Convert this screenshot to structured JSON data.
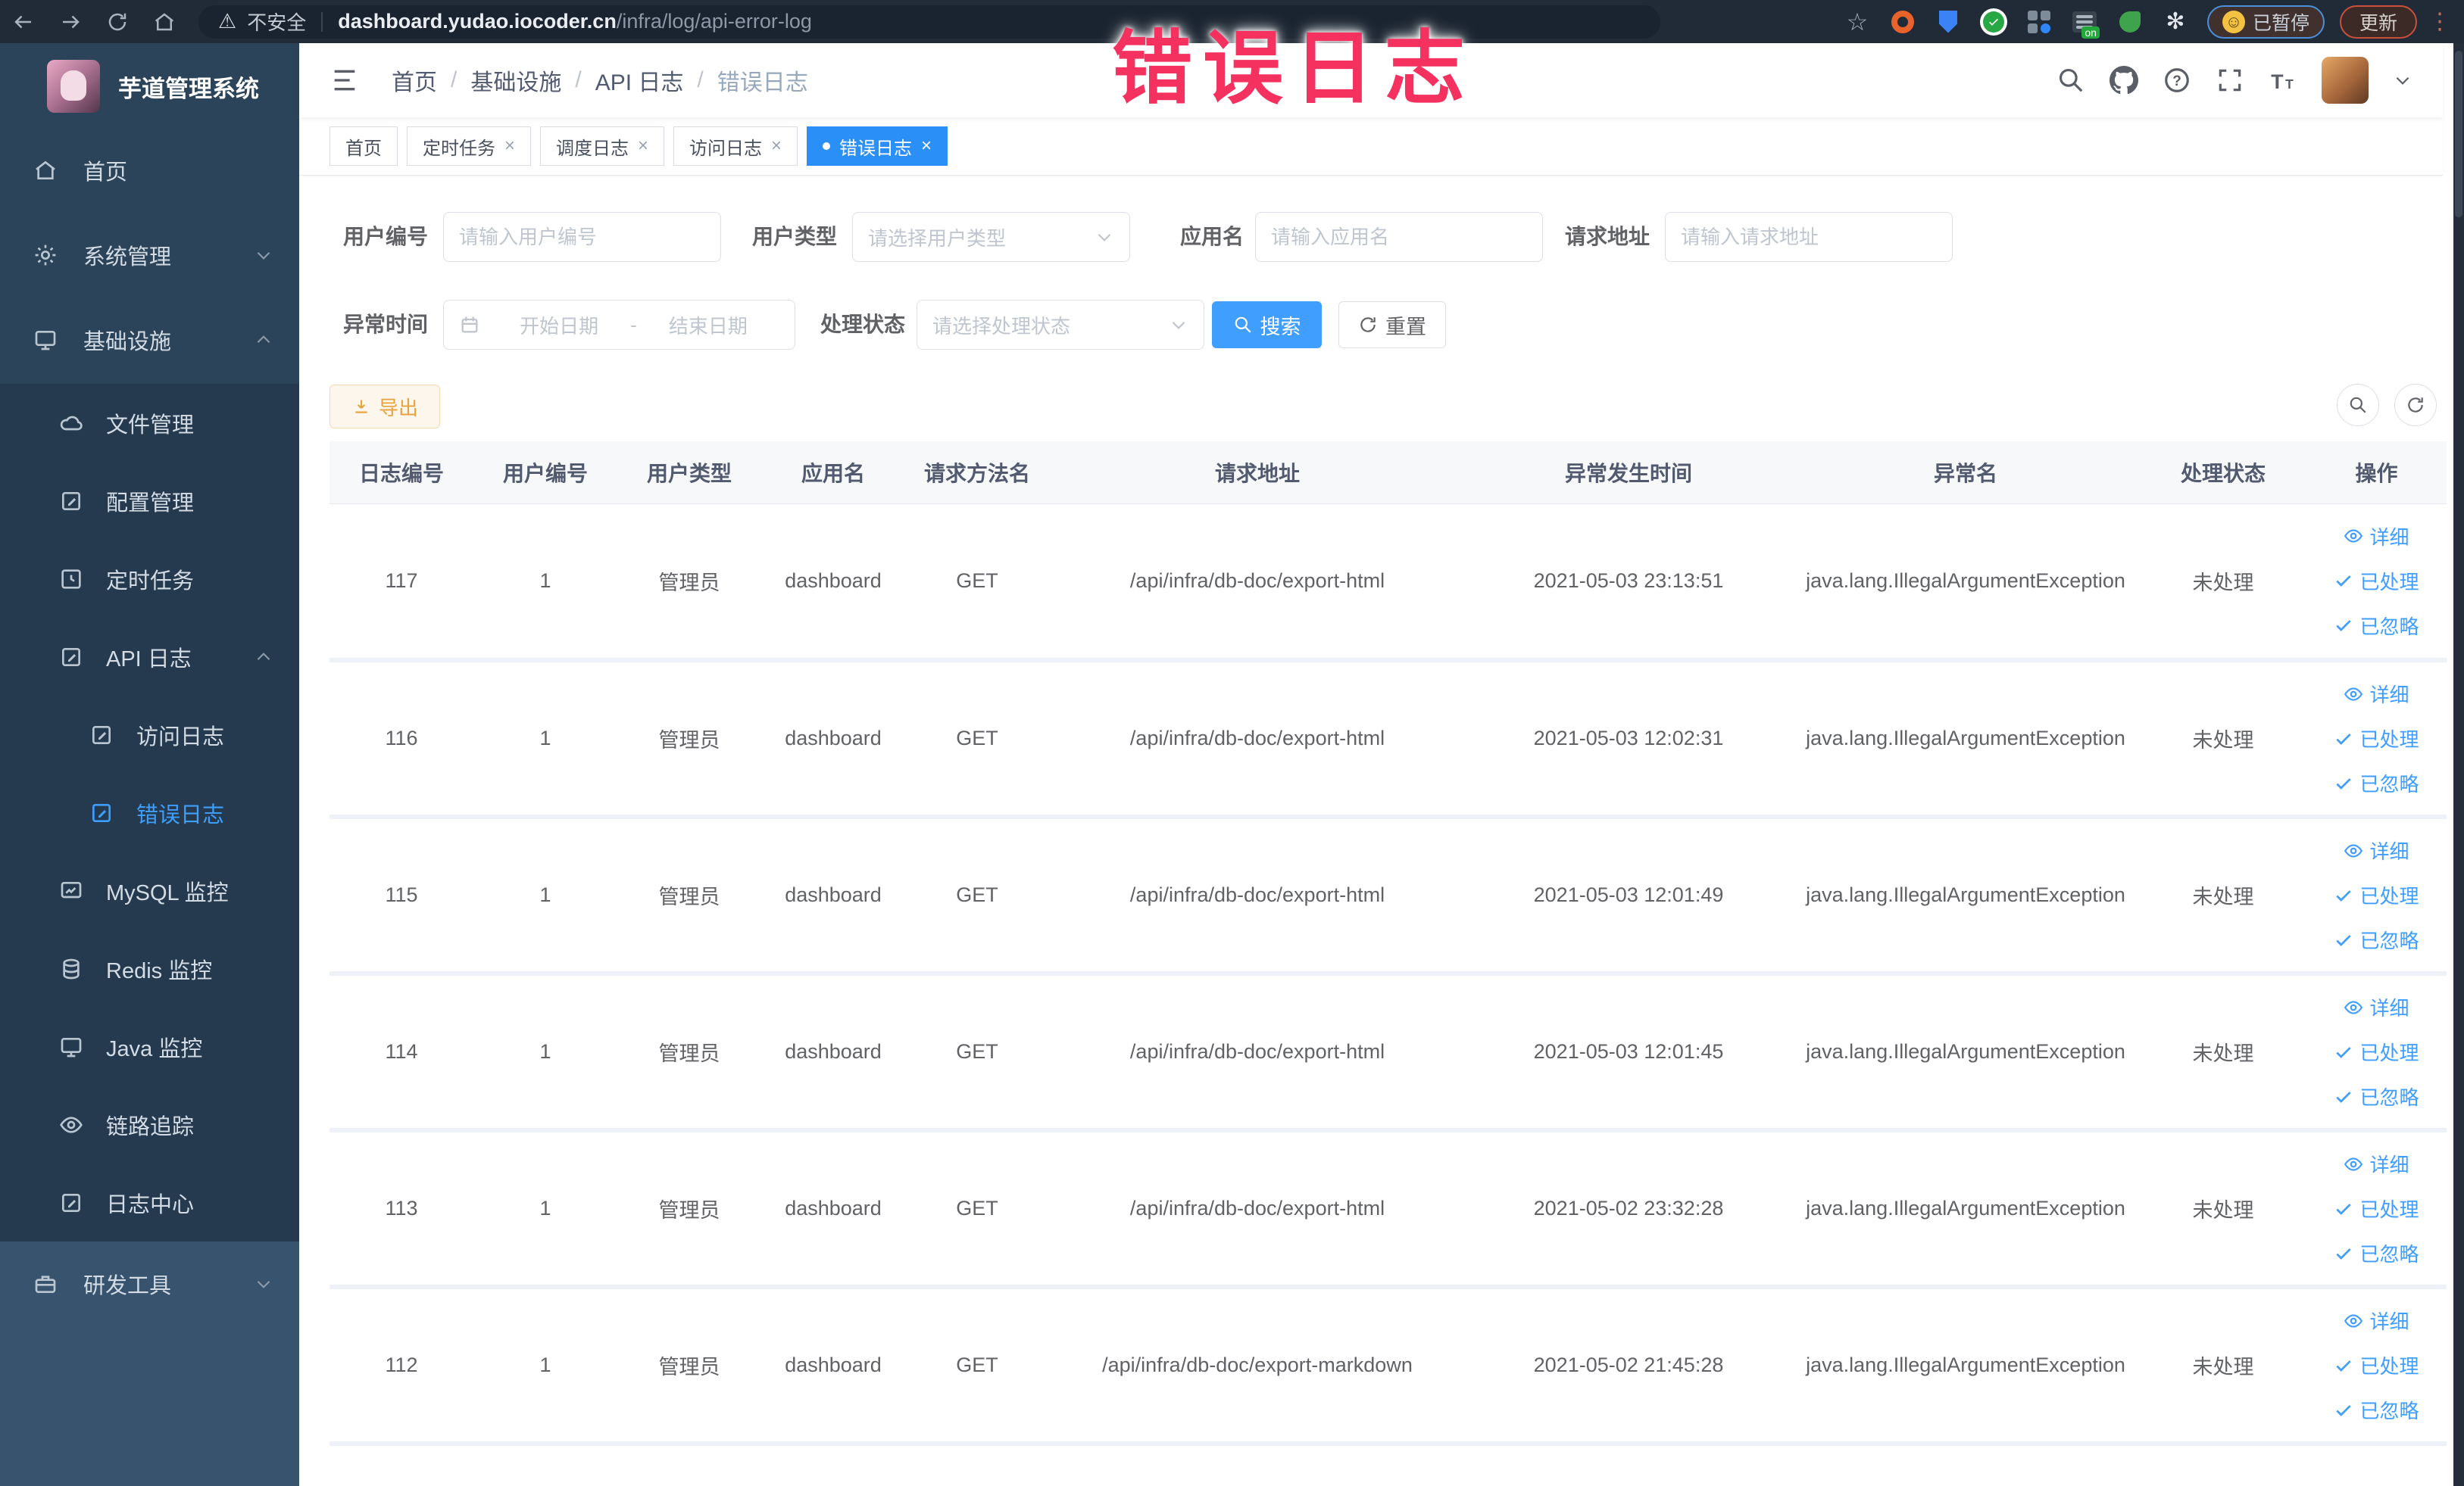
{
  "colors": {
    "accent": "#409eff",
    "annotation_pink": "#f4315f",
    "warning": "#e6a23c",
    "sidebar_bg": "#2c4459",
    "active_tag_bg": "#2a8ff7"
  },
  "annotation": {
    "text": "错误日志"
  },
  "icons": {
    "star": "☆",
    "warning": "⚠",
    "kebab": "⋮",
    "close": "×",
    "separator": "/",
    "puzzle": "✻",
    "smiley": "☺"
  },
  "browser": {
    "security_label": "不安全",
    "url_domain": "dashboard.yudao.iocoder.cn",
    "url_path": "/infra/log/api-error-log",
    "extension_badge": "on",
    "paused_label": "已暂停",
    "update_label": "更新"
  },
  "sidebar": {
    "title": "芋道管理系统",
    "items": [
      {
        "label": "首页"
      },
      {
        "label": "系统管理"
      },
      {
        "label": "基础设施"
      },
      {
        "label": "文件管理"
      },
      {
        "label": "配置管理"
      },
      {
        "label": "定时任务"
      },
      {
        "label": "API 日志"
      },
      {
        "label": "访问日志"
      },
      {
        "label": "错误日志"
      },
      {
        "label": "MySQL 监控"
      },
      {
        "label": "Redis 监控"
      },
      {
        "label": "Java 监控"
      },
      {
        "label": "链路追踪"
      },
      {
        "label": "日志中心"
      },
      {
        "label": "研发工具"
      }
    ]
  },
  "navbar": {
    "breadcrumb": [
      "首页",
      "基础设施",
      "API 日志",
      "错误日志"
    ]
  },
  "tags": [
    {
      "label": "首页"
    },
    {
      "label": "定时任务"
    },
    {
      "label": "调度日志"
    },
    {
      "label": "访问日志"
    },
    {
      "label": "错误日志"
    }
  ],
  "filters": {
    "user_id": {
      "label": "用户编号",
      "placeholder": "请输入用户编号"
    },
    "user_type": {
      "label": "用户类型",
      "placeholder": "请选择用户类型"
    },
    "app_name": {
      "label": "应用名",
      "placeholder": "请输入应用名"
    },
    "request_url": {
      "label": "请求地址",
      "placeholder": "请输入请求地址"
    },
    "exception_time": {
      "label": "异常时间",
      "start_placeholder": "开始日期",
      "separator": "-",
      "end_placeholder": "结束日期"
    },
    "process_status": {
      "label": "处理状态",
      "placeholder": "请选择处理状态"
    },
    "search_label": "搜索",
    "reset_label": "重置"
  },
  "toolbar": {
    "export_label": "导出"
  },
  "table": {
    "columns": [
      "日志编号",
      "用户编号",
      "用户类型",
      "应用名",
      "请求方法名",
      "请求地址",
      "异常发生时间",
      "异常名",
      "处理状态",
      "操作"
    ],
    "actions": [
      "详细",
      "已处理",
      "已忽略"
    ],
    "rows": [
      {
        "id": "117",
        "user_id": "1",
        "user_type": "管理员",
        "app": "dashboard",
        "method": "GET",
        "url": "/api/infra/db-doc/export-html",
        "time": "2021-05-03 23:13:51",
        "exception": "java.lang.IllegalArgumentException",
        "status": "未处理"
      },
      {
        "id": "116",
        "user_id": "1",
        "user_type": "管理员",
        "app": "dashboard",
        "method": "GET",
        "url": "/api/infra/db-doc/export-html",
        "time": "2021-05-03 12:02:31",
        "exception": "java.lang.IllegalArgumentException",
        "status": "未处理"
      },
      {
        "id": "115",
        "user_id": "1",
        "user_type": "管理员",
        "app": "dashboard",
        "method": "GET",
        "url": "/api/infra/db-doc/export-html",
        "time": "2021-05-03 12:01:49",
        "exception": "java.lang.IllegalArgumentException",
        "status": "未处理"
      },
      {
        "id": "114",
        "user_id": "1",
        "user_type": "管理员",
        "app": "dashboard",
        "method": "GET",
        "url": "/api/infra/db-doc/export-html",
        "time": "2021-05-03 12:01:45",
        "exception": "java.lang.IllegalArgumentException",
        "status": "未处理"
      },
      {
        "id": "113",
        "user_id": "1",
        "user_type": "管理员",
        "app": "dashboard",
        "method": "GET",
        "url": "/api/infra/db-doc/export-html",
        "time": "2021-05-02 23:32:28",
        "exception": "java.lang.IllegalArgumentException",
        "status": "未处理"
      },
      {
        "id": "112",
        "user_id": "1",
        "user_type": "管理员",
        "app": "dashboard",
        "method": "GET",
        "url": "/api/infra/db-doc/export-markdown",
        "time": "2021-05-02 21:45:28",
        "exception": "java.lang.IllegalArgumentException",
        "status": "未处理"
      }
    ]
  }
}
